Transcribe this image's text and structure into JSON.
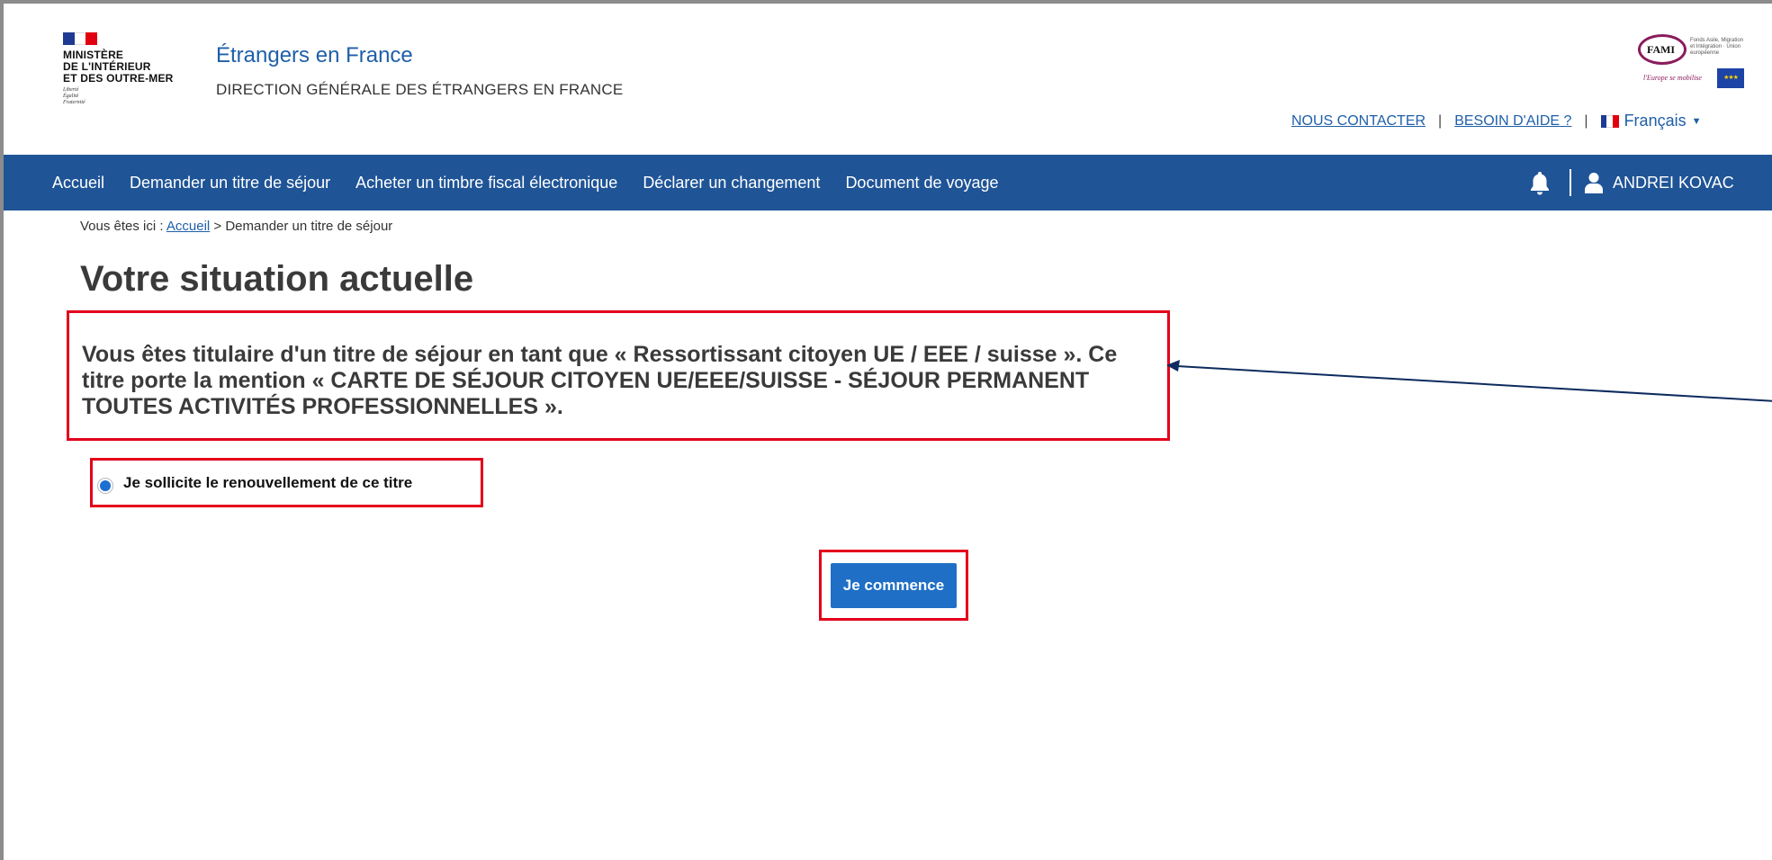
{
  "brand": {
    "ministry_lines": [
      "MINISTÈRE",
      "DE L'INTÉRIEUR",
      "ET DES OUTRE-MER"
    ],
    "motto_lines": [
      "Liberté",
      "Égalité",
      "Fraternité"
    ],
    "site_title": "Étrangers en France",
    "site_subtitle": "DIRECTION GÉNÉRALE DES ÉTRANGERS EN FRANCE",
    "flag_colors": [
      "#1f3a93",
      "#ffffff",
      "#e1000f"
    ]
  },
  "fami": {
    "logo_text": "FAMI",
    "sub_text": "Fonds Asile, Migration et Intégration · Union européenne",
    "motto": "l'Europe se mobilise"
  },
  "top_links": {
    "contact": "NOUS CONTACTER",
    "help": "BESOIN D'AIDE ?",
    "separator": "|",
    "language": "Français"
  },
  "nav": {
    "items": [
      "Accueil",
      "Demander un titre de séjour",
      "Acheter un timbre fiscal électronique",
      "Déclarer un changement",
      "Document de voyage"
    ],
    "user_name": "ANDREI KOVAC"
  },
  "breadcrumb": {
    "prefix": "Vous êtes ici : ",
    "home": "Accueil",
    "current": " > Demander un titre de séjour"
  },
  "main": {
    "title": "Votre situation actuelle",
    "situation_text": "Vous êtes titulaire d'un titre de séjour en tant que « Ressortissant citoyen UE / EEE / suisse ». Ce titre porte la mention « CARTE DE SÉJOUR CITOYEN UE/EEE/SUISSE - SÉJOUR PERMANENT TOUTES ACTIVITÉS PROFESSIONNELLES ».",
    "radio_label": "Je sollicite le renouvellement de ce titre",
    "radio_checked": true,
    "start_button": "Je commence"
  },
  "colors": {
    "nav_bg": "#1f5496",
    "link": "#1f5fa8",
    "highlight": "#e3001b",
    "button": "#1f6fc6"
  }
}
